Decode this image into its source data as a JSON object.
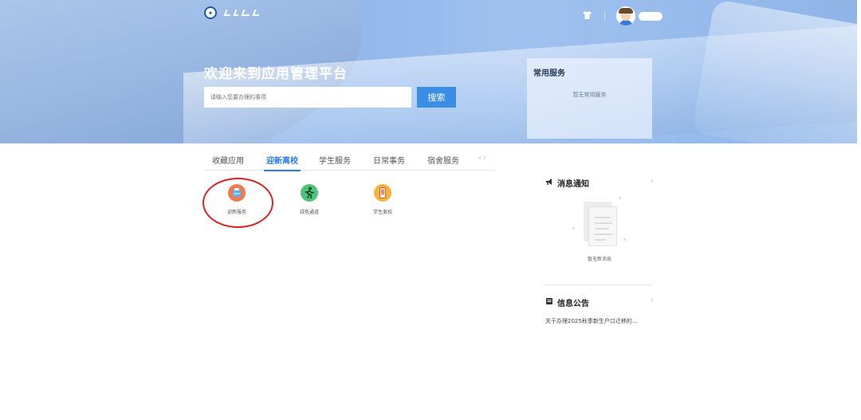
{
  "header": {
    "welcome_title": "欢迎来到应用管理平台",
    "search_placeholder": "请输入您要办理的事项",
    "search_button": "搜索"
  },
  "favorites_panel": {
    "title": "常用服务",
    "empty_text": "暂无常用服务"
  },
  "tabs": [
    {
      "label": "收藏应用",
      "active": false
    },
    {
      "label": "迎新离校",
      "active": true
    },
    {
      "label": "学生服务",
      "active": false
    },
    {
      "label": "日常事务",
      "active": false
    },
    {
      "label": "宿舍服务",
      "active": false
    }
  ],
  "apps": [
    {
      "label": "迎新服务",
      "icon": "welcome-service-icon",
      "color": "#f07a4a"
    },
    {
      "label": "绿色通道",
      "icon": "green-channel-icon",
      "color": "#4fc27a"
    },
    {
      "label": "学生离校",
      "icon": "student-leave-icon",
      "color": "#f5b43a"
    }
  ],
  "news": {
    "title": "消息通知",
    "empty_text": "暂无新消息"
  },
  "notices": {
    "title": "信息公告",
    "items": [
      "关于办理2025秋季新生户口迁移的..."
    ]
  },
  "colors": {
    "accent": "#2c7be5",
    "search_button": "#3a8ee6",
    "highlight": "#dd2222"
  }
}
